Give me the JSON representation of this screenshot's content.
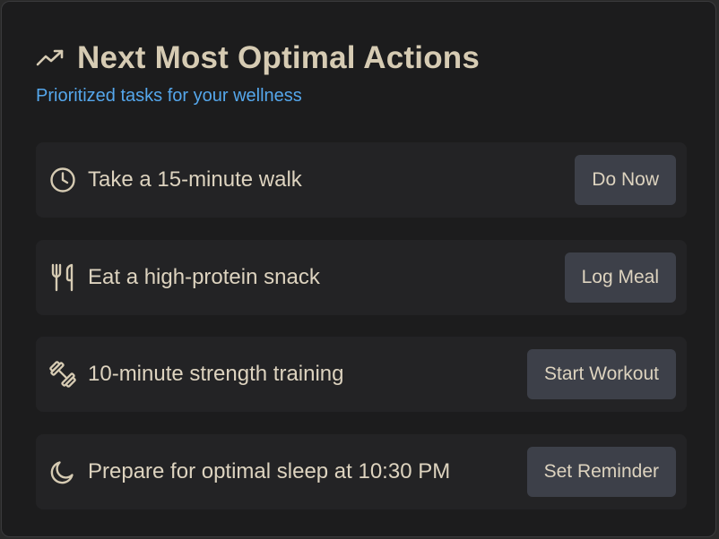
{
  "card": {
    "title": "Next Most Optimal Actions",
    "subtitle": "Prioritized tasks for your wellness",
    "title_icon": "trending-up-icon"
  },
  "actions": [
    {
      "icon": "clock-icon",
      "label": "Take a 15-minute walk",
      "button": "Do Now"
    },
    {
      "icon": "utensils-icon",
      "label": "Eat a high-protein snack",
      "button": "Log Meal"
    },
    {
      "icon": "dumbbell-icon",
      "label": "10-minute strength training",
      "button": "Start Workout"
    },
    {
      "icon": "moon-icon",
      "label": "Prepare for optimal sleep at 10:30 PM",
      "button": "Set Reminder"
    }
  ],
  "colors": {
    "background": "#1c1c1d",
    "row_background": "#232325",
    "title": "#d6cbb3",
    "subtitle": "#55a7ec",
    "button": "#3d4049",
    "text": "#ddd3bf"
  }
}
